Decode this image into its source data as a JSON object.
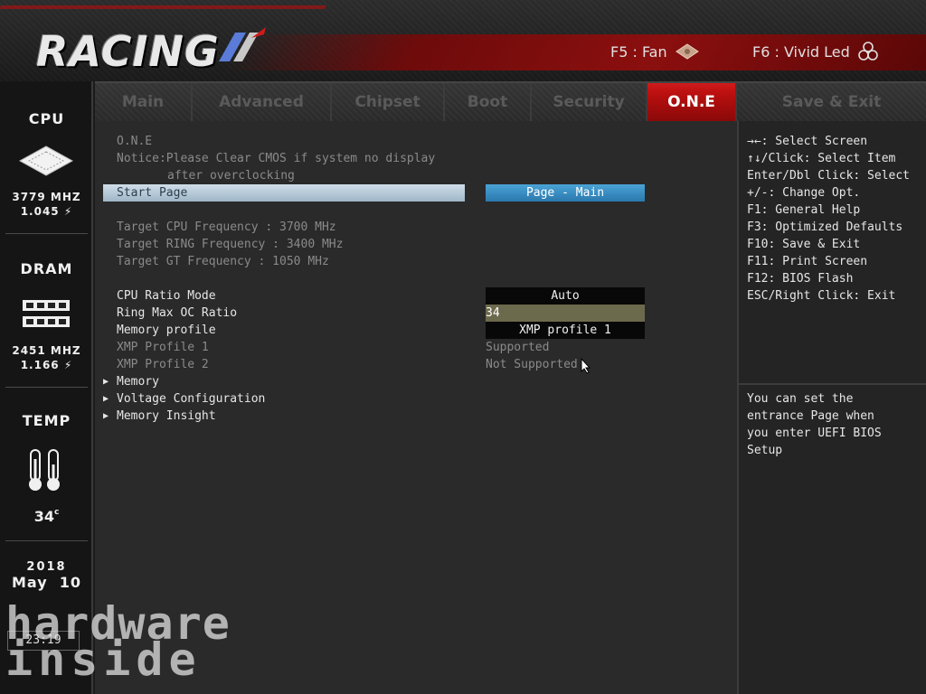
{
  "header": {
    "logo_text": "RACING",
    "hotkeys": [
      {
        "label": "F5 : Fan",
        "icon": "fan-icon"
      },
      {
        "label": "F6 : Vivid Led",
        "icon": "led-icon"
      }
    ]
  },
  "sidebar": {
    "cpu": {
      "title": "CPU",
      "freq": "3779 MHZ",
      "volt": "1.045",
      "icon": "cpu-chip-icon"
    },
    "dram": {
      "title": "DRAM",
      "freq": "2451 MHZ",
      "volt": "1.166",
      "icon": "memory-module-icon"
    },
    "temp": {
      "title": "TEMP",
      "value": "34",
      "unit": "c",
      "icon": "thermometer-icon"
    },
    "date": {
      "year": "2018",
      "month_day": "May  10"
    },
    "time": "23:19"
  },
  "tabs": [
    {
      "label": "Main",
      "active": false
    },
    {
      "label": "Advanced",
      "active": false
    },
    {
      "label": "Chipset",
      "active": false
    },
    {
      "label": "Boot",
      "active": false
    },
    {
      "label": "Security",
      "active": false
    },
    {
      "label": "O.N.E",
      "active": true
    },
    {
      "label": "Save & Exit",
      "active": false
    }
  ],
  "main": {
    "section_title": "O.N.E",
    "notice_line1": "Notice:Please Clear CMOS if system no display",
    "notice_line2": "after overclocking",
    "start_page": {
      "label": "Start Page",
      "value": "Page - Main"
    },
    "targets": [
      "Target CPU Frequency : 3700 MHz",
      "Target RING Frequency : 3400 MHz",
      "Target GT Frequency : 1050 MHz"
    ],
    "settings": [
      {
        "label": "CPU Ratio Mode",
        "value": "Auto"
      },
      {
        "label": "Ring Max OC Ratio",
        "value": "34"
      },
      {
        "label": "Memory profile",
        "value": "XMP profile 1"
      },
      {
        "label": "XMP Profile 1",
        "value": "Supported"
      },
      {
        "label": "XMP Profile 2",
        "value": "Not Supported"
      }
    ],
    "submenus": [
      "Memory",
      "Voltage Configuration",
      "Memory Insight"
    ]
  },
  "help": {
    "keys": [
      "→←: Select Screen",
      "↑↓/Click: Select Item",
      "Enter/Dbl Click: Select",
      "+/-: Change Opt.",
      "F1: General Help",
      "F3: Optimized Defaults",
      "F10: Save & Exit",
      "F11: Print Screen",
      "F12: BIOS Flash",
      "ESC/Right Click: Exit"
    ],
    "description": [
      "You can set the",
      "entrance Page when",
      "you enter UEFI BIOS",
      "Setup"
    ]
  },
  "watermark": {
    "line1": "hardware",
    "line2": "inside"
  },
  "colors": {
    "accent": "#b90f0f",
    "selected_value": "#2a78ad",
    "highlight_row": "#9fb6c7"
  }
}
